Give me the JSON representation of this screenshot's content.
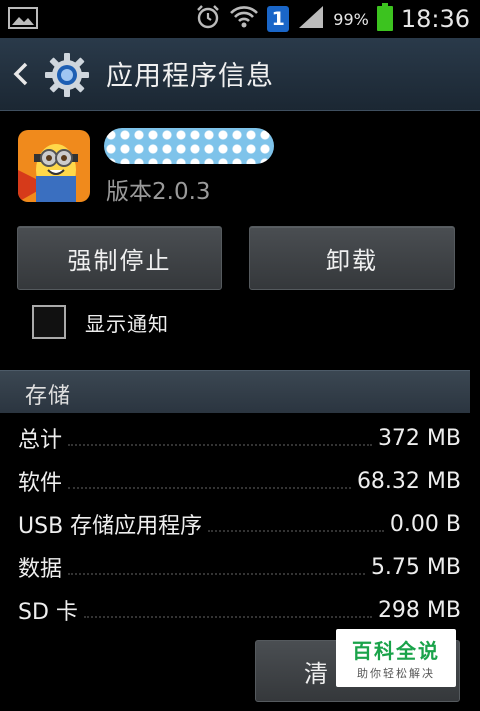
{
  "status_bar": {
    "battery_percent": "99%",
    "time": "18:36",
    "notification_count": "1"
  },
  "header": {
    "title": "应用程序信息"
  },
  "app": {
    "version": "版本2.0.3"
  },
  "actions": {
    "force_stop_label": "强制停止",
    "uninstall_label": "卸载"
  },
  "notifications": {
    "show_label": "显示通知",
    "checked": false
  },
  "storage": {
    "section_title": "存储",
    "rows": [
      {
        "label": "总计",
        "value": "372 MB"
      },
      {
        "label": "软件",
        "value": "68.32 MB"
      },
      {
        "label": "USB 存储应用程序",
        "value": "0.00 B"
      },
      {
        "label": "数据",
        "value": "5.75 MB"
      },
      {
        "label": "SD 卡",
        "value": "298 MB"
      }
    ],
    "clear_button_label": "清"
  },
  "watermark": {
    "brand": "百科全说",
    "tagline": "助你轻松解决"
  },
  "colors": {
    "accent_battery": "#3cc31f",
    "titlebar": "#2a3a4a"
  }
}
